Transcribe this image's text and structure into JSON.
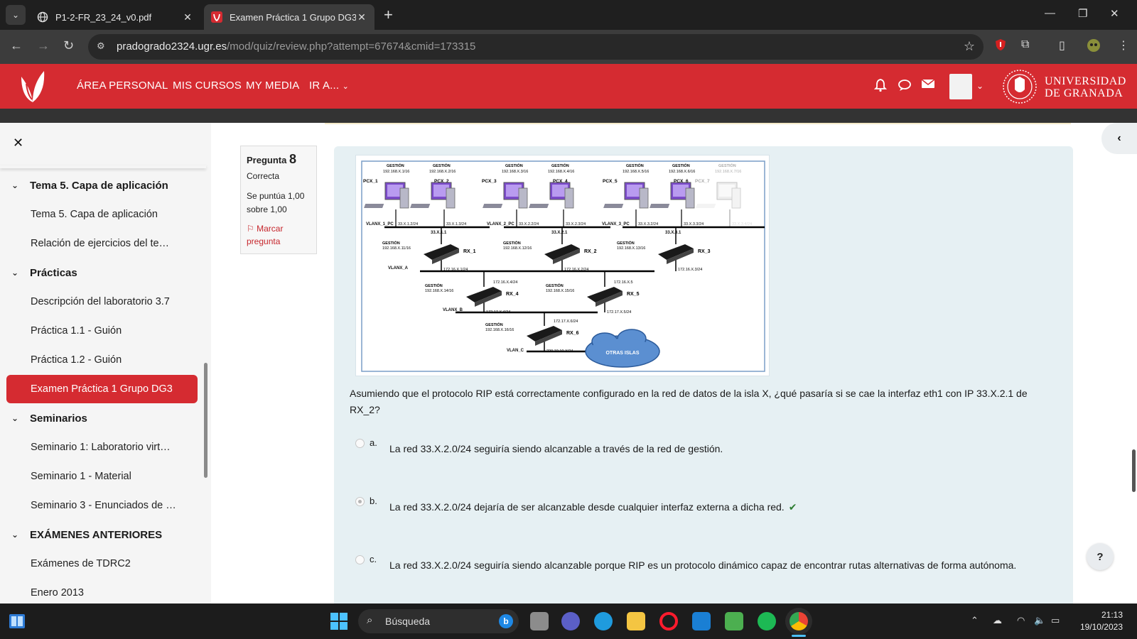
{
  "browser": {
    "tabs": [
      {
        "title": "P1-2-FR_23_24_v0.pdf",
        "active": false
      },
      {
        "title": "Examen Práctica 1 Grupo DG3:",
        "active": true
      }
    ],
    "url_host": "pradogrado2324.ugr.es",
    "url_path": "/mod/quiz/review.php?attempt=67674&cmid=173315"
  },
  "header": {
    "nav": [
      "ÁREA PERSONAL",
      "MIS CURSOS",
      "MY MEDIA",
      "IR A..."
    ],
    "university_line1": "UNIVERSIDAD",
    "university_line2": "DE GRANADA",
    "brand_color": "#d52b31"
  },
  "sidebar": {
    "items": [
      {
        "label": "Tema 5. Capa de aplicación",
        "type": "section"
      },
      {
        "label": "Tema 5. Capa de aplicación",
        "type": "child"
      },
      {
        "label": "Relación de ejercicios del te…",
        "type": "child"
      },
      {
        "label": "Prácticas",
        "type": "section"
      },
      {
        "label": "Descripción del laboratorio 3.7",
        "type": "child"
      },
      {
        "label": "Práctica 1.1 - Guión",
        "type": "child"
      },
      {
        "label": "Práctica 1.2 - Guión",
        "type": "child"
      },
      {
        "label": "Examen Práctica 1 Grupo DG3",
        "type": "active"
      },
      {
        "label": "Seminarios",
        "type": "section"
      },
      {
        "label": "Seminario 1: Laboratorio virt…",
        "type": "child"
      },
      {
        "label": "Seminario 1 - Material",
        "type": "child"
      },
      {
        "label": "Seminario 3 - Enunciados de …",
        "type": "child"
      },
      {
        "label": "EXÁMENES ANTERIORES",
        "type": "section"
      },
      {
        "label": "Exámenes de TDRC2",
        "type": "child"
      },
      {
        "label": "Enero 2013",
        "type": "child"
      }
    ]
  },
  "question": {
    "label": "Pregunta",
    "number": "8",
    "state": "Correcta",
    "grade": "Se puntúa 1,00 sobre 1,00",
    "flag": "Marcar pregunta",
    "text": "Asumiendo que el protocolo RIP está correctamente configurado en la red de datos de la isla X, ¿qué pasaría si se cae la interfaz eth1 con IP 33.X.2.1 de RX_2?",
    "answers": [
      {
        "letter": "a.",
        "text": "La red 33.X.2.0/24 seguiría siendo alcanzable a través de la red de gestión.",
        "selected": false,
        "correct": false
      },
      {
        "letter": "b.",
        "text": "La red 33.X.2.0/24 dejaría de ser alcanzable desde cualquier interfaz externa a dicha red.",
        "selected": true,
        "correct": true
      },
      {
        "letter": "c.",
        "text": "La red 33.X.2.0/24 seguiría siendo alcanzable porque RIP es un protocolo dinámico capaz de encontrar rutas alternativas de forma autónoma.",
        "selected": false,
        "correct": false
      }
    ]
  },
  "diagram": {
    "gestion_label": "GESTIÓN",
    "pcs": [
      {
        "name": "PCX_1",
        "gestion": "192.168.X.1/16",
        "ip": "33.X.1.2/24"
      },
      {
        "name": "PCX_2",
        "gestion": "192.168.X.2/16",
        "ip": "33.X.1.3/24"
      },
      {
        "name": "PCX_3",
        "gestion": "192.168.X.3/16",
        "ip": "33.X.2.2/24"
      },
      {
        "name": "PCX_4",
        "gestion": "192.168.X.4/16",
        "ip": "33.X.2.3/24"
      },
      {
        "name": "PCX_5",
        "gestion": "192.168.X.5/16",
        "ip": "33.X.3.2/24"
      },
      {
        "name": "PCX_6",
        "gestion": "192.168.X.6/16",
        "ip": "33.X.3.3/24"
      },
      {
        "name": "PCX_7",
        "gestion": "192.168.X.7/16",
        "ip": "33.X.3.4/24"
      }
    ],
    "vlans_pc": [
      "VLANX_1_PC",
      "VLANX_2_PC",
      "VLANX_3_PC"
    ],
    "gateways": [
      "33.X.1.1",
      "33.X.2.1",
      "33.X.3.1"
    ],
    "routers": [
      {
        "name": "RX_1",
        "gestion": "192.168.X.11/16",
        "ip": "172.16.X.1/24"
      },
      {
        "name": "RX_2",
        "gestion": "192.168.X.12/16",
        "ip": "172.16.X.2/24"
      },
      {
        "name": "RX_3",
        "gestion": "192.168.X.13/16",
        "ip": "172.16.X.3/24"
      },
      {
        "name": "RX_4",
        "gestion": "192.168.X.14/16",
        "ip": "172.17.X.4/24",
        "up": "172.16.X.4/24"
      },
      {
        "name": "RX_5",
        "gestion": "192.168.X.15/16",
        "ip": "172.17.X.5/24",
        "up": "172.16.X.5"
      },
      {
        "name": "RX_6",
        "gestion": "192.168.X.16/16",
        "ip": "220.10.10.X/24",
        "up": "172.17.X.6/24"
      }
    ],
    "vlan_a": "VLANX_A",
    "vlan_b": "VLANX_B",
    "vlan_c": "VLAN_C",
    "cloud": "OTRAS ISLAS"
  },
  "taskbar": {
    "search": "Búsqueda",
    "time": "21:13",
    "date": "19/10/2023"
  }
}
